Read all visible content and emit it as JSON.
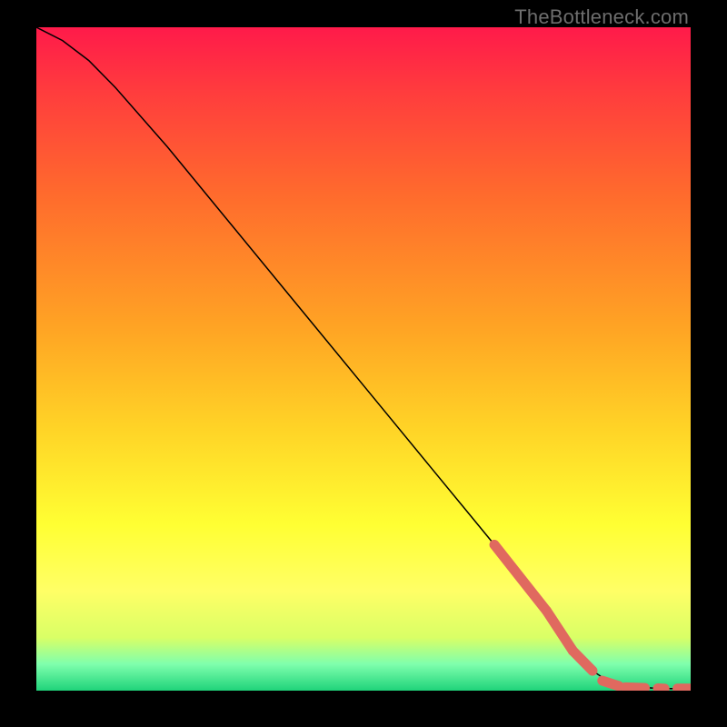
{
  "watermark": "TheBottleneck.com",
  "chart_data": {
    "type": "line",
    "title": "",
    "xlabel": "",
    "ylabel": "",
    "xlim": [
      0,
      100
    ],
    "ylim": [
      0,
      100
    ],
    "grid": false,
    "series": [
      {
        "name": "curve",
        "x": [
          0,
          4,
          8,
          12,
          20,
          30,
          40,
          50,
          60,
          70,
          78,
          82,
          85,
          88,
          92,
          96,
          100
        ],
        "y": [
          100,
          98,
          95,
          91,
          82,
          70,
          58,
          46,
          34,
          22,
          12,
          6,
          3,
          1,
          0.5,
          0.3,
          0.3
        ]
      }
    ],
    "highlight_segments": [
      {
        "x": [
          70,
          78
        ],
        "y": [
          22,
          12
        ]
      },
      {
        "x": [
          78,
          82
        ],
        "y": [
          12,
          6
        ]
      },
      {
        "x": [
          82,
          85
        ],
        "y": [
          6,
          3
        ]
      },
      {
        "x": [
          86.5,
          89
        ],
        "y": [
          1.5,
          0.7
        ]
      },
      {
        "x": [
          90,
          93
        ],
        "y": [
          0.5,
          0.4
        ]
      },
      {
        "x": [
          95,
          96
        ],
        "y": [
          0.35,
          0.3
        ]
      },
      {
        "x": [
          98,
          100
        ],
        "y": [
          0.3,
          0.3
        ]
      }
    ],
    "highlight_color": "#e0695f",
    "line_color": "#000000"
  }
}
